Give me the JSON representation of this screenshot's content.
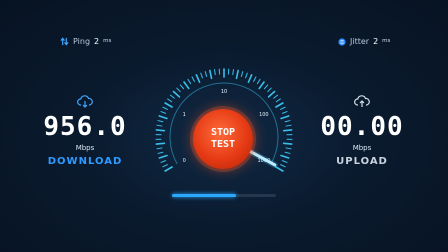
{
  "stats": {
    "ping": {
      "label": "Ping",
      "value": "2",
      "unit": "ms",
      "icon": "ping-arrows-icon"
    },
    "jitter": {
      "label": "Jitter",
      "value": "2",
      "unit": "ms",
      "icon": "jitter-icon"
    }
  },
  "download": {
    "value": "956.0",
    "unit": "Mbps",
    "label": "DOWNLOAD",
    "icon": "cloud-download-icon"
  },
  "upload": {
    "value": "00.00",
    "unit": "Mbps",
    "label": "UPLOAD",
    "icon": "cloud-upload-icon"
  },
  "gauge": {
    "ticks": [
      {
        "label": "0",
        "value": 0
      },
      {
        "label": "1",
        "value": 1
      },
      {
        "label": "10",
        "value": 10
      },
      {
        "label": "100",
        "value": 100
      },
      {
        "label": "1000",
        "value": 1000
      }
    ],
    "reading": 956.0
  },
  "button": {
    "line1": "STOP",
    "line2": "TEST"
  },
  "progress": {
    "fraction": 0.62
  },
  "colors": {
    "accent": "#2f9bff",
    "button": "#e53a14",
    "gauge": "#3fd0ff"
  }
}
